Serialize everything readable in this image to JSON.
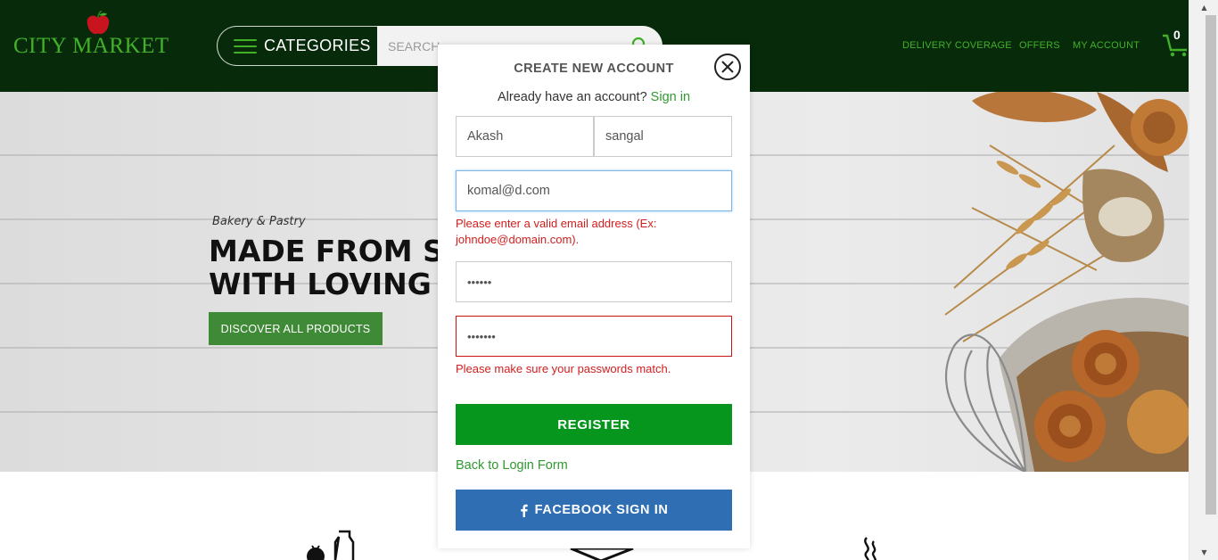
{
  "header": {
    "logo_text": "CITY MARKET",
    "categories_label": "CATEGORIES",
    "search_placeholder": "SEARCH",
    "nav": [
      "DELIVERY COVERAGE",
      "OFFERS",
      "MY ACCOUNT"
    ],
    "cart_count": "0"
  },
  "hero": {
    "subtitle": "Bakery & Pastry",
    "title_line1": "MADE FROM SC",
    "title_line2": "WITH LOVING C",
    "cta_label": "DISCOVER ALL PRODUCTS"
  },
  "modal": {
    "title": "CREATE NEW ACCOUNT",
    "already_text": "Already have an account?",
    "signin_link": "Sign in",
    "first_name_value": "Akash",
    "last_name_value": "sangal",
    "email_value": "komal@d.com",
    "email_error": "Please enter a valid email address (Ex: johndoe@domain.com).",
    "password_value": "••••••",
    "confirm_password_value": "•••••••",
    "password_error": "Please make sure your passwords match.",
    "register_label": "REGISTER",
    "back_link": "Back to Login Form",
    "facebook_label": "FACEBOOK SIGN IN"
  },
  "colors": {
    "header_bg": "#062a0a",
    "brand_green": "#43b02a",
    "register_green": "#06961e",
    "facebook_blue": "#2f6eb3",
    "error_red": "#d21e1e"
  }
}
